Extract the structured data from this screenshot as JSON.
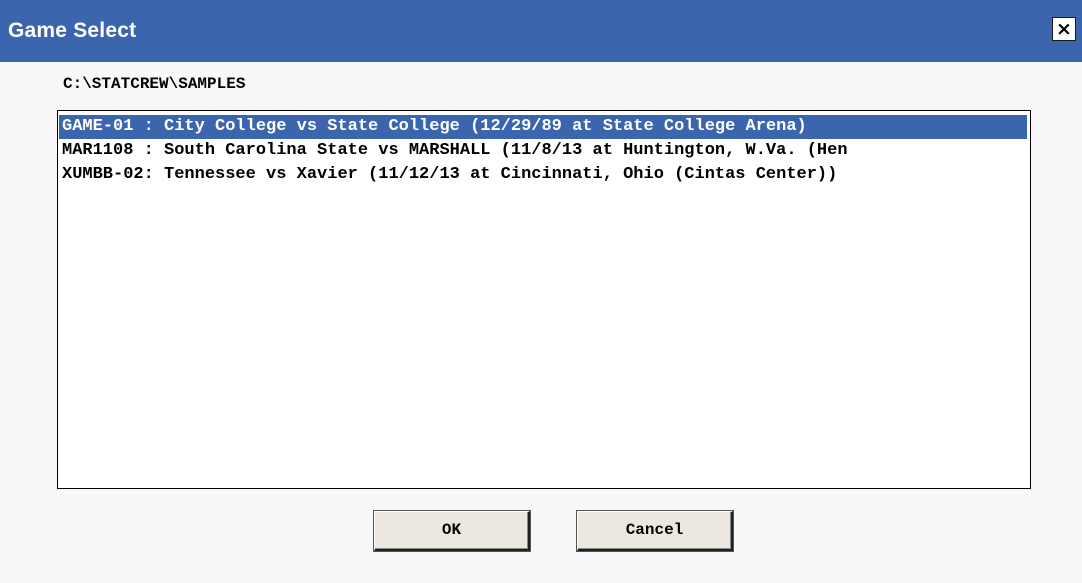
{
  "window": {
    "title": "Game Select",
    "close_glyph": "×"
  },
  "path": "C:\\STATCREW\\SAMPLES",
  "games": [
    {
      "text": "GAME-01 : City College vs State College (12/29/89 at State College Arena)",
      "selected": true
    },
    {
      "text": "MAR1108 : South Carolina State vs MARSHALL (11/8/13 at Huntington, W.Va. (Hen",
      "selected": false
    },
    {
      "text": "XUMBB-02: Tennessee vs Xavier (11/12/13 at Cincinnati, Ohio (Cintas Center))",
      "selected": false
    }
  ],
  "buttons": {
    "ok_label": "OK",
    "cancel_label": "Cancel"
  },
  "colors": {
    "titlebar": "#3b66ad",
    "selection": "#3b66ad",
    "button_face": "#ece8df"
  },
  "icons": {
    "close": "close-icon"
  }
}
